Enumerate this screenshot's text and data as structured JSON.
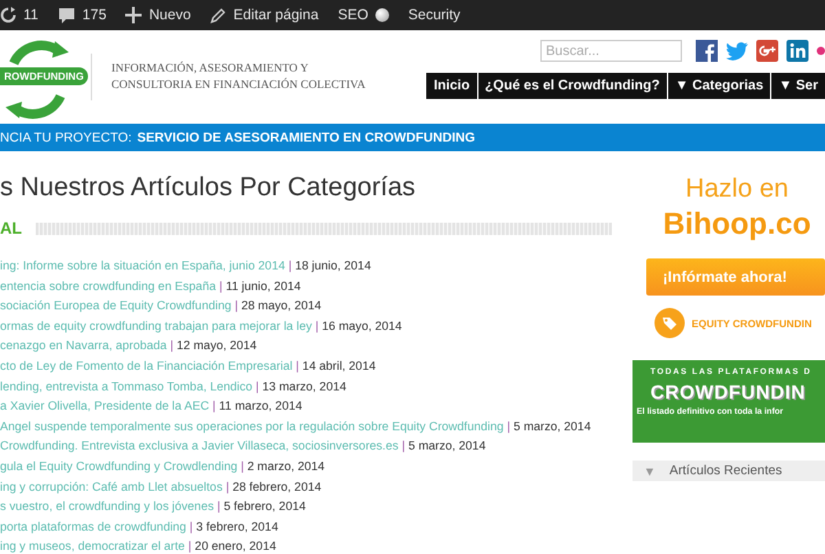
{
  "admin_bar": {
    "items": [
      {
        "kind": "updates",
        "label": "11"
      },
      {
        "kind": "comments",
        "label": "175"
      },
      {
        "kind": "new",
        "label": "Nuevo"
      },
      {
        "kind": "edit",
        "label": "Editar página"
      },
      {
        "kind": "seo",
        "label": "SEO"
      },
      {
        "kind": "plain",
        "label": "Security"
      }
    ]
  },
  "header": {
    "logo_text": "ROWDFUNDING",
    "tagline": [
      "INFORMACIÓN, ASESORAMIENTO Y",
      "CONSULTORIA EN FINANCIACIÓN COLECTIVA"
    ],
    "search": {
      "placeholder": "Buscar..."
    },
    "nav": [
      {
        "label": "Inicio"
      },
      {
        "label": "¿Qué es el Crowdfunding?"
      },
      {
        "label": "Categorias",
        "caret": "▼"
      },
      {
        "label": "Ser",
        "caret": "▼"
      }
    ]
  },
  "promo_bar": {
    "lead": "NCIA TU PROYECTO:",
    "link": "SERVICIO DE ASESORAMIENTO EN CROWDFUNDING"
  },
  "main": {
    "title": "s Nuestros Artículos Por Categorías",
    "section": "AL",
    "articles": [
      {
        "title": "ing: Informe sobre la situación en España, junio 2014",
        "separator": "|",
        "date": "18 junio, 2014"
      },
      {
        "title": "entencia sobre crowdfunding en España",
        "separator": "|",
        "date": "11 junio, 2014"
      },
      {
        "title": "sociación Europea de Equity Crowdfunding",
        "separator": "|",
        "date": "28 mayo, 2014"
      },
      {
        "title": "ormas de equity crowdfunding trabajan para mejorar la ley",
        "separator": "|",
        "date": "16 mayo, 2014"
      },
      {
        "title": "cenazgo en Navarra, aprobada",
        "separator": "|",
        "date": "12 mayo, 2014"
      },
      {
        "title": "cto de Ley de Fomento de la Financiación Empresarial",
        "separator": "|",
        "date": "14 abril, 2014"
      },
      {
        "title": "lending, entrevista a Tommaso Tomba, Lendico",
        "separator": "|",
        "date": "13 marzo, 2014"
      },
      {
        "title": "a Xavier Olivella, Presidente de la AEC",
        "separator": "|",
        "date": "11 marzo, 2014"
      },
      {
        "title": "Angel suspende temporalmente sus operaciones por la regulación sobre Equity Crowdfunding",
        "separator": "|",
        "date": "5 marzo, 2014"
      },
      {
        "title": "Crowdfunding. Entrevista exclusiva a Javier Villaseca, sociosinversores.es",
        "separator": "|",
        "date": "5 marzo, 2014"
      },
      {
        "title": "gula el Equity Crowdfunding y Crowdlending",
        "separator": "|",
        "date": "2 marzo, 2014"
      },
      {
        "title": "ing y corrupción: Café amb Llet absueltos",
        "separator": "|",
        "date": "28 febrero, 2014"
      },
      {
        "title": "s vuestro, el crowdfunding y los jóvenes",
        "separator": "|",
        "date": "5 febrero, 2014"
      },
      {
        "title": "porta plataformas de crowdfunding",
        "separator": "|",
        "date": "3 febrero, 2014"
      },
      {
        "title": "ing y museos, democratizar el arte",
        "separator": "|",
        "date": "20 enero, 2014"
      }
    ]
  },
  "sidebar": {
    "ad_line": "Hazlo en",
    "ad_brand": "Bihoop.co",
    "ad_button": "¡Infórmate ahora!",
    "ad_tag": "EQUITY CROWDFUNDIN",
    "banner": {
      "top": "TODAS LAS PLATAFORMAS D",
      "title": "CROWDFUNDIN",
      "subtitle": "El listado definitivo con toda la infor"
    },
    "widget": {
      "title": "Artículos Recientes",
      "expanded": true,
      "caret": "▼"
    }
  }
}
